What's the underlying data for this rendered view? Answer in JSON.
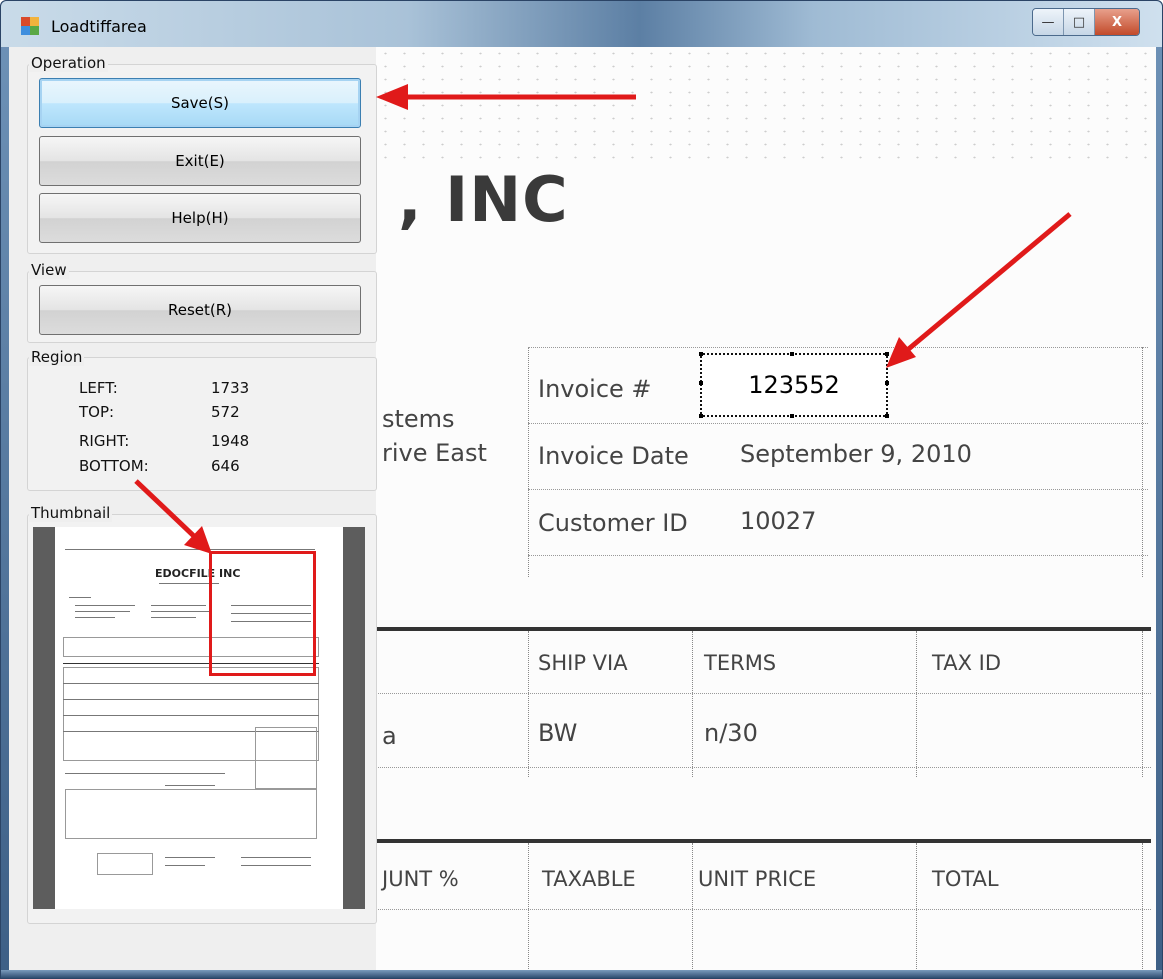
{
  "window": {
    "title": "Loadtiffarea",
    "minimize_glyph": "—",
    "maximize_glyph": "□",
    "close_glyph": "X"
  },
  "operation": {
    "label": "Operation",
    "save_label": "Save(S)",
    "exit_label": "Exit(E)",
    "help_label": "Help(H)"
  },
  "view": {
    "label": "View",
    "reset_label": "Reset(R)"
  },
  "region": {
    "label": "Region",
    "rows": [
      {
        "name": "LEFT:",
        "value": "1733"
      },
      {
        "name": "TOP:",
        "value": "572"
      },
      {
        "name": "RIGHT:",
        "value": "1948"
      },
      {
        "name": "BOTTOM:",
        "value": "646"
      }
    ]
  },
  "thumbnail": {
    "label": "Thumbnail",
    "doc_title": "EDOCFILE INC"
  },
  "document": {
    "company": ", INC",
    "addr1": "stems",
    "addr2": "rive East",
    "invoice_label": "Invoice #",
    "invoice_value": "123552",
    "date_label": "Invoice Date",
    "date_value": "September 9, 2010",
    "customer_label": "Customer ID",
    "customer_value": "10027",
    "ship_via_header": "SHIP VIA",
    "terms_header": "TERMS",
    "tax_id_header": "TAX ID",
    "row_a": "a",
    "ship_via_value": "BW",
    "terms_value": "n/30",
    "discount_header": "JUNT %",
    "taxable_header": "TAXABLE",
    "unit_price_header": "UNIT PRICE",
    "total_header": "TOTAL"
  },
  "colors": {
    "annotation_red": "#e01a1a",
    "focus_blue": "#3c7fb1"
  }
}
